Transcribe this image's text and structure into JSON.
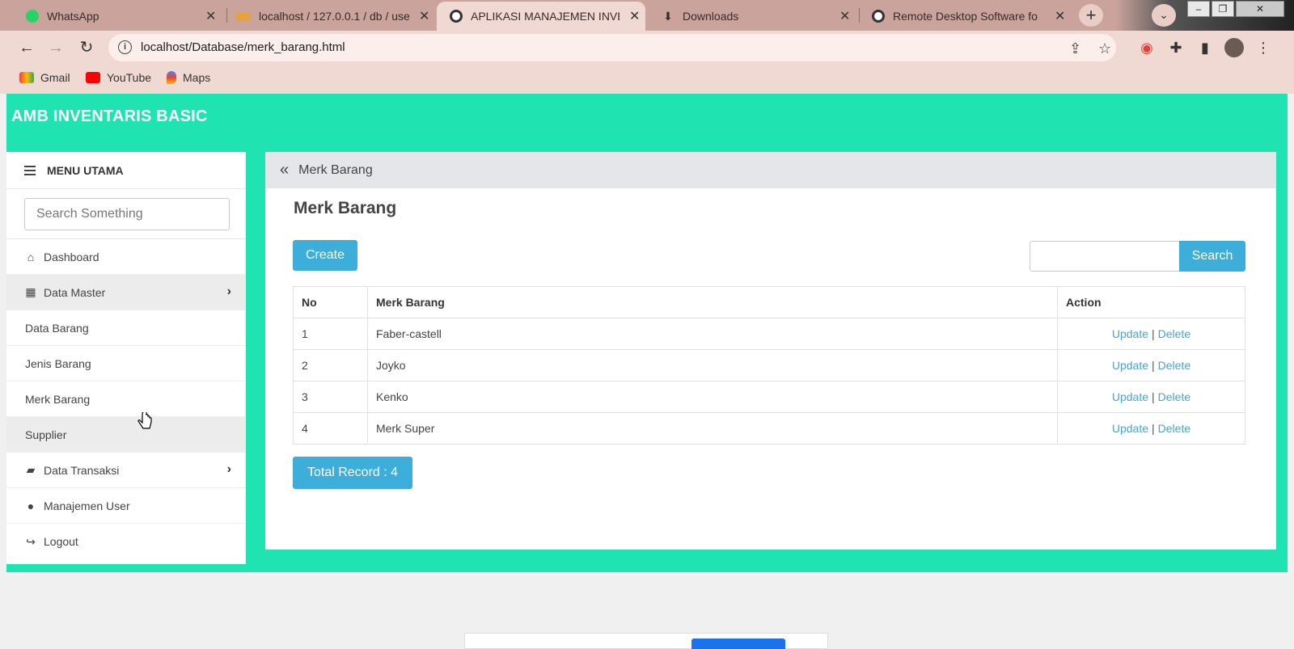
{
  "browser": {
    "tabs": [
      {
        "label": "WhatsApp",
        "icon": "whatsapp-icon",
        "active": false
      },
      {
        "label": "localhost / 127.0.0.1 / db / use",
        "icon": "phpmyadmin-icon",
        "active": false
      },
      {
        "label": "APLIKASI MANAJEMEN INVEN",
        "icon": "globe-icon",
        "active": true
      },
      {
        "label": "Downloads",
        "icon": "download-icon",
        "active": false
      },
      {
        "label": "Remote Desktop Software for",
        "icon": "globe-icon",
        "active": false
      }
    ],
    "url": "localhost/Database/merk_barang.html",
    "bookmarks": [
      {
        "label": "Gmail",
        "icon": "gmail-icon"
      },
      {
        "label": "YouTube",
        "icon": "youtube-icon"
      },
      {
        "label": "Maps",
        "icon": "maps-icon"
      }
    ]
  },
  "app": {
    "brand": "AMB INVENTARIS BASIC",
    "colors": {
      "header": "#20e3b2",
      "button": "#3daed9",
      "link": "#4aa3d2"
    }
  },
  "sidebar": {
    "title": "MENU UTAMA",
    "search_placeholder": "Search Something",
    "items": [
      {
        "label": "Dashboard",
        "icon": "home-icon"
      },
      {
        "label": "Data Master",
        "icon": "grid-icon",
        "expandable": true
      },
      {
        "label": "Data Barang"
      },
      {
        "label": "Jenis Barang"
      },
      {
        "label": "Merk Barang"
      },
      {
        "label": "Supplier"
      },
      {
        "label": "Data Transaksi",
        "icon": "folder-open-icon",
        "expandable": true
      },
      {
        "label": "Manajemen User",
        "icon": "user-icon"
      },
      {
        "label": "Logout",
        "icon": "logout-icon"
      }
    ]
  },
  "main": {
    "breadcrumb": "Merk Barang",
    "title": "Merk Barang",
    "create_label": "Create",
    "search_label": "Search",
    "search_value": "",
    "table": {
      "headers": [
        "No",
        "Merk Barang",
        "Action"
      ],
      "rows": [
        {
          "no": "1",
          "name": "Faber-castell"
        },
        {
          "no": "2",
          "name": "Joyko"
        },
        {
          "no": "3",
          "name": "Kenko"
        },
        {
          "no": "4",
          "name": "Merk Super"
        }
      ],
      "update_label": "Update",
      "delete_label": "Delete",
      "separator": "|"
    },
    "total_label": "Total Record : 4"
  }
}
